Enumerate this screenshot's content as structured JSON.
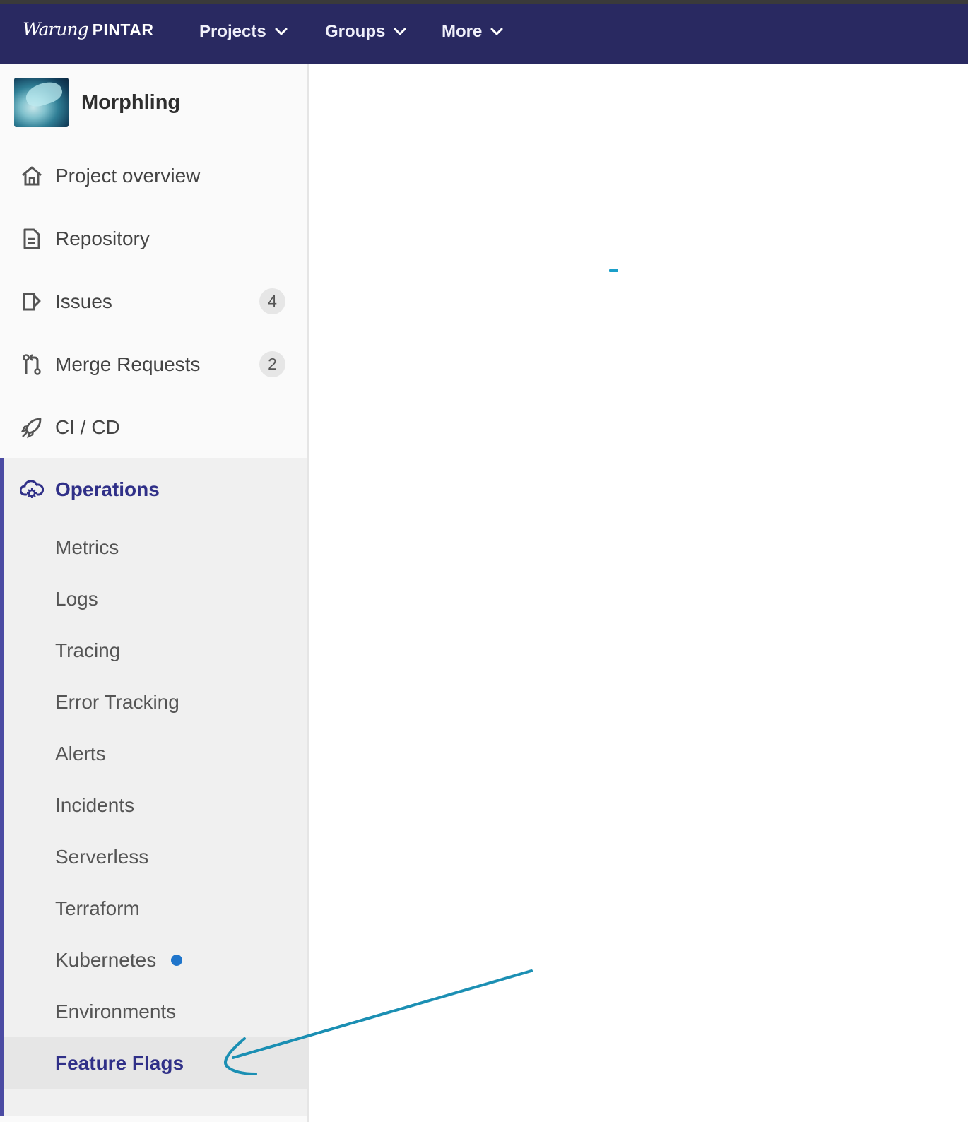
{
  "brand": {
    "script": "Warung",
    "word": "PINTAR",
    "colors": {
      "topbar": "#292961",
      "accent": "#303088",
      "arrow": "#1b8fb3"
    }
  },
  "topnav": [
    {
      "label": "Projects",
      "icon": "chevron-down-icon"
    },
    {
      "label": "Groups",
      "icon": "chevron-down-icon"
    },
    {
      "label": "More",
      "icon": "chevron-down-icon"
    }
  ],
  "sidebar": {
    "project_name": "Morphling",
    "items": [
      {
        "label": "Project overview",
        "icon": "home-icon"
      },
      {
        "label": "Repository",
        "icon": "document-icon"
      },
      {
        "label": "Issues",
        "icon": "issues-icon",
        "badge": "4"
      },
      {
        "label": "Merge Requests",
        "icon": "merge-request-icon",
        "badge": "2"
      },
      {
        "label": "CI / CD",
        "icon": "rocket-icon"
      }
    ],
    "operations": {
      "label": "Operations",
      "icon": "cloud-gear-icon",
      "subitems": [
        {
          "label": "Metrics"
        },
        {
          "label": "Logs"
        },
        {
          "label": "Tracing"
        },
        {
          "label": "Error Tracking"
        },
        {
          "label": "Alerts"
        },
        {
          "label": "Incidents"
        },
        {
          "label": "Serverless"
        },
        {
          "label": "Terraform"
        },
        {
          "label": "Kubernetes",
          "indicator": "blue-dot"
        },
        {
          "label": "Environments"
        },
        {
          "label": "Feature Flags",
          "active": true
        }
      ]
    }
  },
  "main": {
    "loading_indicator": "spinner"
  }
}
